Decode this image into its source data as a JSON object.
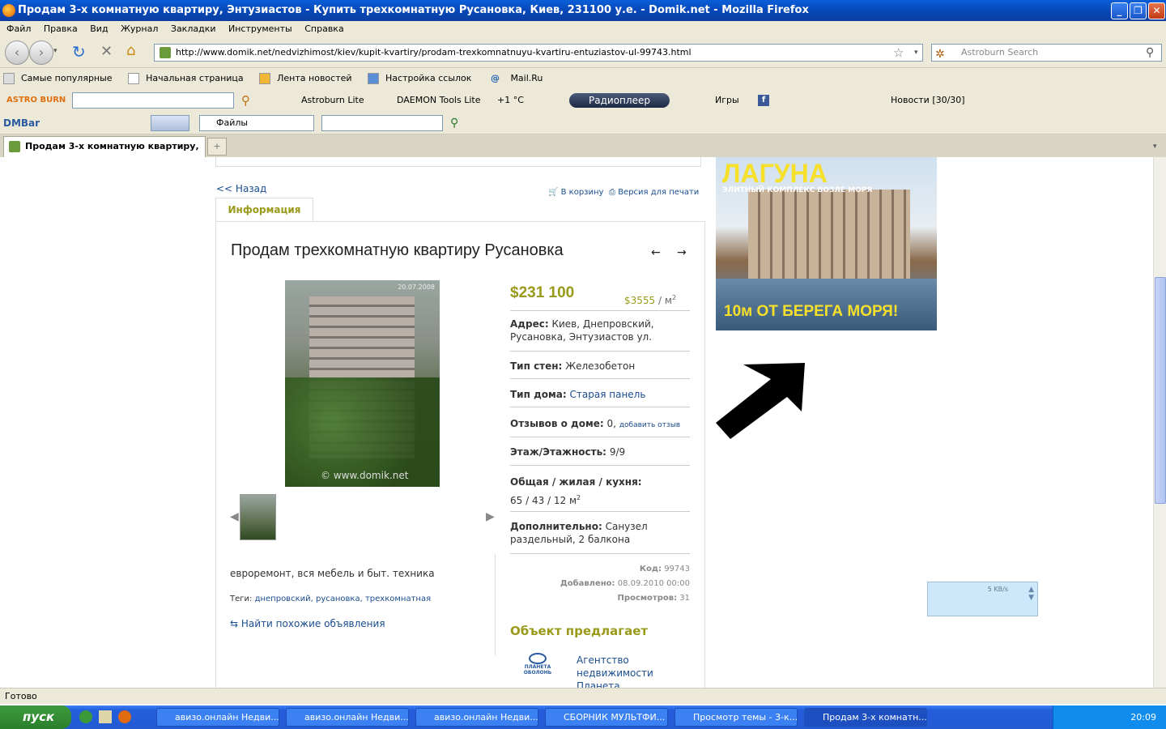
{
  "window": {
    "title": "Продам 3-х комнатную квартиру, Энтузиастов - Купить трехкомнатную Русановка, Киев, 231100 у.е. - Domik.net - Mozilla Firefox",
    "minimize": "_",
    "maximize": "❐",
    "close": "✕"
  },
  "menu": [
    "Файл",
    "Правка",
    "Вид",
    "Журнал",
    "Закладки",
    "Инструменты",
    "Справка"
  ],
  "nav": {
    "url": "http://www.domik.net/nedvizhimost/kiev/kupit-kvartiry/prodam-trexkomnatnuyu-kvartiru-entuziastov-ul-99743.html",
    "search_placeholder": "Astroburn Search"
  },
  "bookmarks": [
    "Самые популярные",
    "Начальная страница",
    "Лента новостей",
    "Настройка ссылок",
    "Mail.Ru"
  ],
  "toolbar1": {
    "logo": "ASTRO BURN",
    "astroburn": "Astroburn Lite",
    "daemon": "DAEMON Tools Lite",
    "weather": "+1 °C",
    "radio": "Радиоплеер",
    "games": "Игры",
    "news": "Новости [30/30]"
  },
  "toolbar2": {
    "dmbar": "DMBar",
    "files": "Файлы"
  },
  "tab": {
    "title": "Продам 3-х комнатную квартиру, ..."
  },
  "page": {
    "back": "<< Назад",
    "to_cart": "В корзину",
    "print": "Версия для печати",
    "tab_info": "Информация",
    "heading": "Продам трехкомнатную квартиру Русановка",
    "prev_arrow": "←",
    "next_arrow": "→",
    "photo_date": "20.07.2008",
    "watermark": "© www.domik.net",
    "price": "$231 100",
    "price_m2": "$3555",
    "price_m2_unit": "/ м",
    "address_label": "Адрес:",
    "address": "Киев, Днепровский, Русановка, Энтузиастов ул.",
    "walls_label": "Тип стен:",
    "walls": "Железобетон",
    "house_label": "Тип дома:",
    "house": "Старая панель",
    "reviews_label": "Отзывов о доме:",
    "reviews": "0,",
    "add_review": "добавить отзыв",
    "floor_label": "Этаж/Этажность:",
    "floor": "9/9",
    "area_label": "Общая / жилая / кухня:",
    "area": "65 / 43 / 12 м",
    "extra_label": "Дополнительно:",
    "extra": "Санузел раздельный, 2 балкона",
    "code_label": "Код:",
    "code": "99743",
    "added_label": "Добавлено:",
    "added": "08.09.2010 00:00",
    "views_label": "Просмотров:",
    "views": "31",
    "description": "евроремонт, вся мебель и быт. техника",
    "tags_label": "Теги:",
    "tags": [
      "днепровский,",
      "русановка,",
      "трехкомнатная"
    ],
    "similar": "Найти похожие объявления",
    "offer_title": "Объект предлагает",
    "agency": "Агентство недвижимости Планета Оболонь",
    "agency_logo_text": "ПЛАНЕТА ОБОЛОНЬ"
  },
  "ad": {
    "brand": "ЛАГУНА",
    "subtitle": "ЭЛИТНЫЙ КОМПЛЕКС ВОЗЛЕ МОРЯ",
    "slogan": "10м ОТ БЕРЕГА МОРЯ!"
  },
  "speed_widget": "5 KB/s",
  "status": "Готово",
  "taskbar": {
    "start": "пуск",
    "items": [
      "авизо.онлайн Недви...",
      "авизо.онлайн Недви...",
      "авизо.онлайн Недви...",
      "СБОРНИК МУЛЬТФИ...",
      "Просмотр темы - 3-к...",
      "Продам 3-х комнатн..."
    ],
    "clock": "20:09"
  }
}
